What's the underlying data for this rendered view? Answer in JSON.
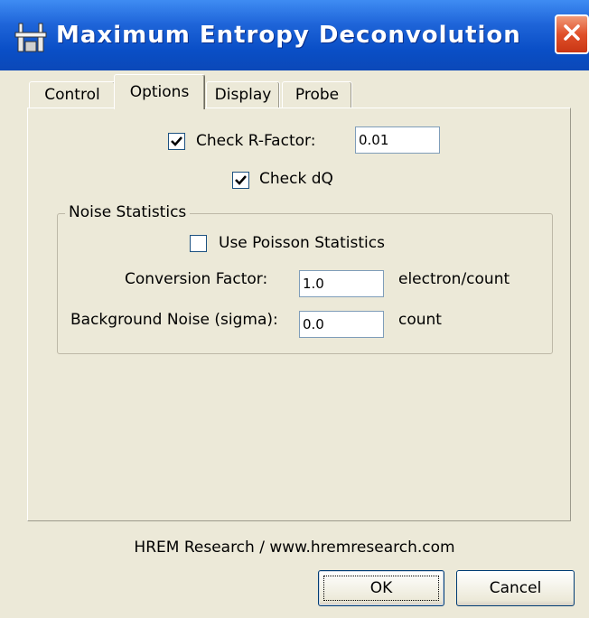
{
  "window": {
    "title": "Maximum Entropy Deconvolution",
    "close_icon": "close-icon",
    "app_icon": "app-icon"
  },
  "tabs": [
    {
      "label": "Control",
      "active": false
    },
    {
      "label": "Options",
      "active": true
    },
    {
      "label": "Display",
      "active": false
    },
    {
      "label": "Probe",
      "active": false
    }
  ],
  "options": {
    "check_rfactor": {
      "label": "Check R-Factor:",
      "checked": true,
      "value": "0.01"
    },
    "check_dq": {
      "label": "Check dQ",
      "checked": true
    },
    "noise": {
      "title": "Noise Statistics",
      "use_poisson": {
        "label": "Use Poisson Statistics",
        "checked": false
      },
      "conversion": {
        "label": "Conversion Factor:",
        "value": "1.0",
        "unit": "electron/count"
      },
      "background": {
        "label": "Background Noise (sigma):",
        "value": "0.0",
        "unit": "count"
      }
    }
  },
  "footer": {
    "text": "HREM Research / www.hremresearch.com"
  },
  "buttons": {
    "ok": "OK",
    "cancel": "Cancel"
  },
  "colors": {
    "title_bar": "#0a4fc7",
    "dialog_bg": "#ece9d8",
    "close": "#e0502a"
  }
}
